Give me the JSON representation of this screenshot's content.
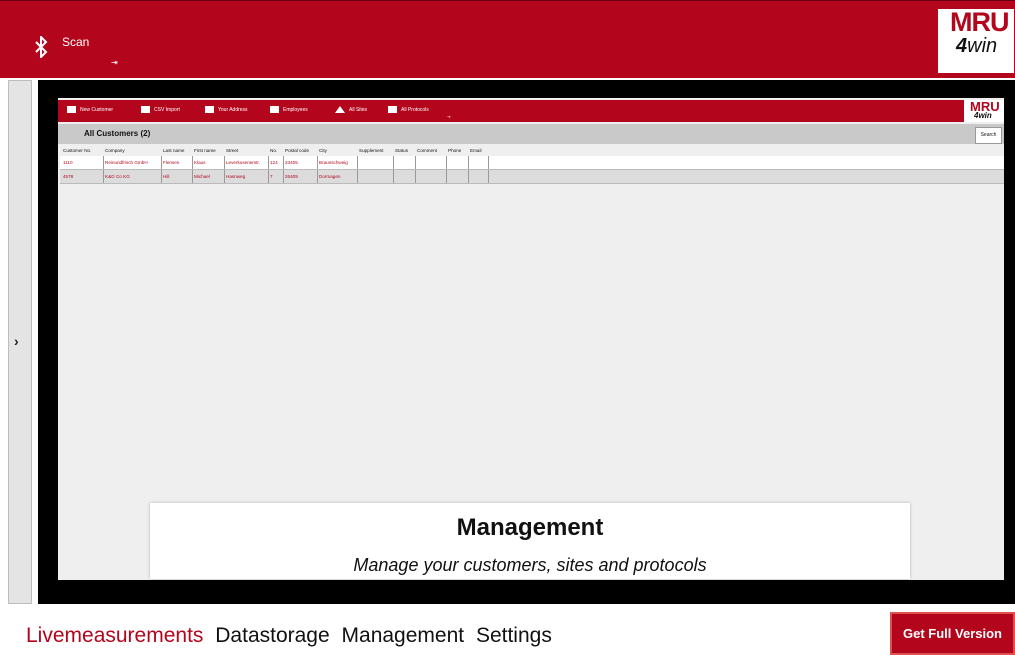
{
  "header": {
    "scan_label": "Scan",
    "cursor_glyph": "⇥"
  },
  "logo": {
    "mru": "MRU",
    "four": "4",
    "win": "win"
  },
  "inner": {
    "toolbar": [
      "New Customer",
      "CSV Import",
      "Your Address",
      "Employees",
      "All Sites",
      "All Protocols"
    ],
    "toolbar_icons": [
      "person-card-icon",
      "import-icon",
      "address-card-icon",
      "employees-icon",
      "home-icon",
      "protocol-icon"
    ],
    "cursor_glyph": "⇥",
    "logo": {
      "mru": "MRU",
      "win": "4win"
    },
    "title": "All Customers (2)",
    "search_label": "Search",
    "columns": [
      "Customer No.",
      "Company",
      "Last name",
      "First name",
      "Street",
      "No.",
      "Postal code",
      "City",
      "Supplement",
      "Status",
      "Comment",
      "Phone",
      "Email"
    ],
    "rows": [
      [
        "1110",
        "Reinundfrisch GmbH",
        "Flensen",
        "Klaus",
        "Leverkusenerstr.",
        "124",
        "23405",
        "Braunschweig",
        "",
        "",
        "",
        "",
        ""
      ],
      [
        "4578",
        "K&G Co KG",
        "Hill",
        "Michael",
        "Hasnweg",
        "7",
        "26409",
        "Dormagen",
        "",
        "",
        "",
        "",
        ""
      ]
    ]
  },
  "side_toggle": {
    "glyph": "›"
  },
  "overlay": {
    "title": "Management",
    "subtitle": "Manage your customers, sites and protocols"
  },
  "bottom_nav": {
    "items": [
      "Livemeasurements",
      "Datastorage",
      "Management",
      "Settings"
    ],
    "active_index": 0
  },
  "full_version_label": "Get Full Version",
  "colors": {
    "brand_red": "#b3061d",
    "white": "#ffffff",
    "black": "#000000"
  }
}
